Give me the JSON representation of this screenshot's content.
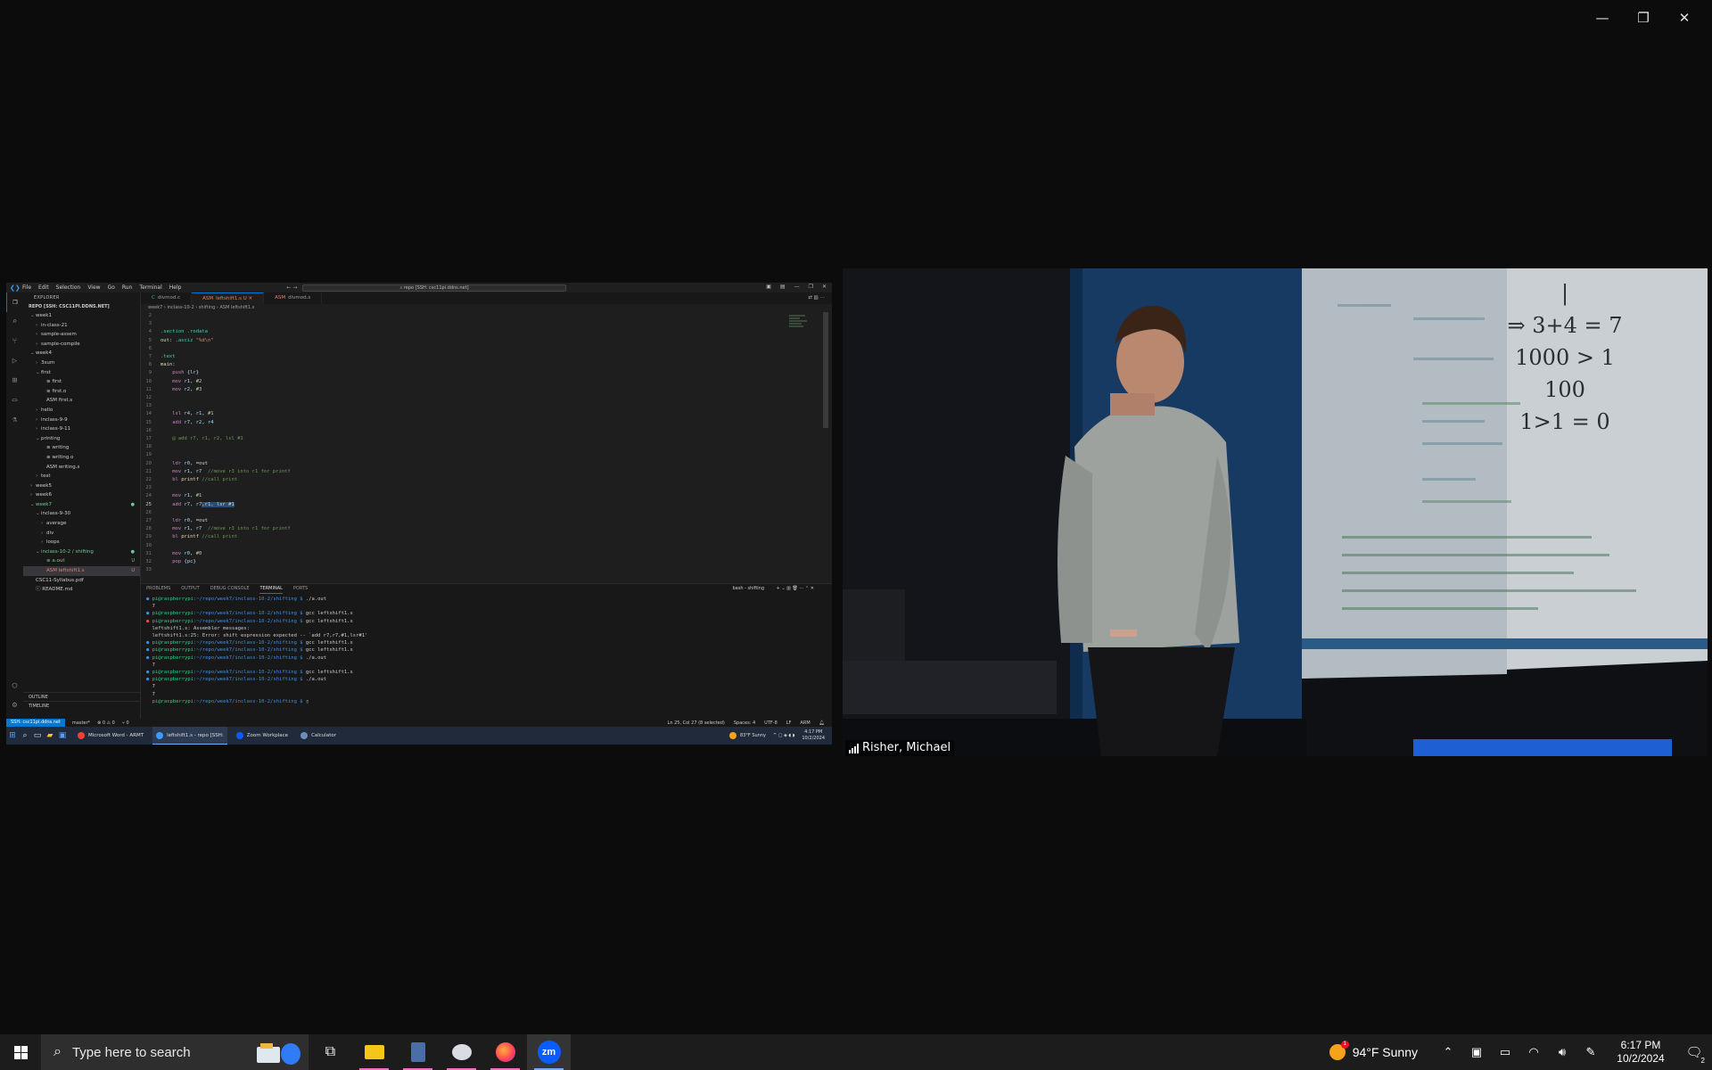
{
  "window_controls": {
    "minimize": "—",
    "restore": "❐",
    "close": "✕"
  },
  "vscode": {
    "menu": [
      "File",
      "Edit",
      "Selection",
      "View",
      "Go",
      "Run",
      "Terminal",
      "Help"
    ],
    "command_center": "repo [SSH: csc11pi.ddns.net]",
    "explorer": {
      "header": "EXPLORER",
      "repo": "REPO [SSH: CSC11PI.DDNS.NET]",
      "items": [
        {
          "label": "week1",
          "depth": 0,
          "chev": "⌄",
          "color": ""
        },
        {
          "label": "in-class-21",
          "depth": 1,
          "chev": "›",
          "color": ""
        },
        {
          "label": "sample-assem",
          "depth": 1,
          "chev": "›",
          "color": ""
        },
        {
          "label": "sample-compile",
          "depth": 1,
          "chev": "›",
          "color": ""
        },
        {
          "label": "week4",
          "depth": 0,
          "chev": "⌄",
          "color": ""
        },
        {
          "label": "3sum",
          "depth": 1,
          "chev": "›",
          "color": ""
        },
        {
          "label": "first",
          "depth": 1,
          "chev": "⌄",
          "color": ""
        },
        {
          "label": "≡ first",
          "depth": 2,
          "chev": "",
          "color": ""
        },
        {
          "label": "≡ first.o",
          "depth": 2,
          "chev": "",
          "color": ""
        },
        {
          "label": "ASM first.s",
          "depth": 2,
          "chev": "",
          "color": ""
        },
        {
          "label": "hello",
          "depth": 1,
          "chev": "›",
          "color": ""
        },
        {
          "label": "inclass-9-9",
          "depth": 1,
          "chev": "›",
          "color": ""
        },
        {
          "label": "inclass-9-11",
          "depth": 1,
          "chev": "›",
          "color": ""
        },
        {
          "label": "printing",
          "depth": 1,
          "chev": "⌄",
          "color": ""
        },
        {
          "label": "≡ writing",
          "depth": 2,
          "chev": "",
          "color": ""
        },
        {
          "label": "≡ writing.o",
          "depth": 2,
          "chev": "",
          "color": ""
        },
        {
          "label": "ASM writing.s",
          "depth": 2,
          "chev": "",
          "color": ""
        },
        {
          "label": "test",
          "depth": 1,
          "chev": "›",
          "color": ""
        },
        {
          "label": "week5",
          "depth": 0,
          "chev": "›",
          "color": ""
        },
        {
          "label": "week6",
          "depth": 0,
          "chev": "›",
          "color": ""
        },
        {
          "label": "week7",
          "depth": 0,
          "chev": "⌄",
          "color": "green",
          "badge": "●"
        },
        {
          "label": "inclass-9-30",
          "depth": 1,
          "chev": "⌄",
          "color": ""
        },
        {
          "label": "average",
          "depth": 2,
          "chev": "›",
          "color": ""
        },
        {
          "label": "div",
          "depth": 2,
          "chev": "›",
          "color": ""
        },
        {
          "label": "loops",
          "depth": 2,
          "chev": "›",
          "color": ""
        },
        {
          "label": "inclass-10-2 / shifting",
          "depth": 1,
          "chev": "⌄",
          "color": "green",
          "badge": "●"
        },
        {
          "label": "≡ a.out",
          "depth": 2,
          "chev": "",
          "color": "green",
          "badge": "U"
        },
        {
          "label": "ASM leftshift1.s",
          "depth": 2,
          "chev": "",
          "color": "red",
          "badge": "U",
          "selected": true
        },
        {
          "label": "CSC11-Syllabus.pdf",
          "depth": 0,
          "chev": "",
          "color": ""
        },
        {
          "label": "ⓘ README.md",
          "depth": 0,
          "chev": "",
          "color": ""
        }
      ],
      "outline": "OUTLINE",
      "timeline": "TIMELINE"
    },
    "tabs": [
      {
        "icon": "C",
        "label": "divmod.c",
        "active": false
      },
      {
        "icon": "ASM",
        "label": "leftshift1.s U",
        "active": true
      },
      {
        "icon": "ASM",
        "label": "divmod.s",
        "active": false
      }
    ],
    "breadcrumb": "week7 › inclass-10-2 › shifting › ASM leftshift1.s",
    "code": [
      {
        "n": "2",
        "html": ""
      },
      {
        "n": "3",
        "html": ""
      },
      {
        "n": "4",
        "html": "<span class='dir'>.section .rodata</span>"
      },
      {
        "n": "5",
        "html": "<span class='lbl'>out:</span> <span class='dir'>.asciz</span> <span class='str'>\"%d\\n\"</span>"
      },
      {
        "n": "6",
        "html": ""
      },
      {
        "n": "7",
        "html": "<span class='dir'>.text</span>"
      },
      {
        "n": "8",
        "html": "<span class='lbl'>main:</span>"
      },
      {
        "n": "9",
        "html": "    <span class='kw'>push</span> <span class='tx'>{</span><span class='reg'>lr</span><span class='tx'>}</span>"
      },
      {
        "n": "10",
        "html": "    <span class='kw'>mov</span> <span class='reg'>r1</span>, <span class='num'>#2</span>"
      },
      {
        "n": "11",
        "html": "    <span class='kw'>mov</span> <span class='reg'>r2</span>, <span class='num'>#3</span>"
      },
      {
        "n": "12",
        "html": ""
      },
      {
        "n": "13",
        "html": ""
      },
      {
        "n": "14",
        "html": "    <span class='kw'>lsl</span> <span class='reg'>r4</span>, <span class='reg'>r1</span>, <span class='num'>#1</span>"
      },
      {
        "n": "15",
        "html": "    <span class='kw'>add</span> <span class='reg'>r7</span>, <span class='reg'>r2</span>, <span class='reg'>r4</span>"
      },
      {
        "n": "16",
        "html": ""
      },
      {
        "n": "17",
        "html": "    <span class='cm'>@ add r7, r1, r2, lsl #1</span>"
      },
      {
        "n": "18",
        "html": ""
      },
      {
        "n": "19",
        "html": ""
      },
      {
        "n": "20",
        "html": "    <span class='kw'>ldr</span> <span class='reg'>r0</span>, <span class='tx'>=out</span>"
      },
      {
        "n": "21",
        "html": "    <span class='kw'>mov</span> <span class='reg'>r1</span>, <span class='reg'>r7</span>  <span class='cm'>//move r3 into r1 for printf</span>"
      },
      {
        "n": "22",
        "html": "    <span class='kw'>bl</span> <span class='lbl'>printf</span> <span class='cm'>//call print</span>"
      },
      {
        "n": "23",
        "html": ""
      },
      {
        "n": "24",
        "html": "    <span class='kw'>mov</span> <span class='reg'>r1</span>, <span class='num'>#1</span>"
      },
      {
        "n": "25",
        "html": "    <span class='kw'>add</span> <span class='reg'>r7</span>, <span class='reg'>r7</span><span class='hl'>,r1, lsr #1</span>",
        "cur": true
      },
      {
        "n": "26",
        "html": ""
      },
      {
        "n": "27",
        "html": "    <span class='kw'>ldr</span> <span class='reg'>r0</span>, <span class='tx'>=out</span>"
      },
      {
        "n": "28",
        "html": "    <span class='kw'>mov</span> <span class='reg'>r1</span>, <span class='reg'>r7</span>  <span class='cm'>//move r3 into r1 for printf</span>"
      },
      {
        "n": "29",
        "html": "    <span class='kw'>bl</span> <span class='lbl'>printf</span> <span class='cm'>//call print</span>"
      },
      {
        "n": "30",
        "html": ""
      },
      {
        "n": "31",
        "html": "    <span class='kw'>mov</span> <span class='reg'>r0</span>, <span class='num'>#0</span>"
      },
      {
        "n": "32",
        "html": "    <span class='kw'>pop</span> <span class='tx'>{</span><span class='reg'>pc</span><span class='tx'>}</span>"
      },
      {
        "n": "33",
        "html": ""
      }
    ],
    "panel": {
      "tabs": [
        "PROBLEMS",
        "OUTPUT",
        "DEBUG CONSOLE",
        "TERMINAL",
        "PORTS"
      ],
      "active_tab": "TERMINAL",
      "shell": "bash - shifting",
      "terminal": [
        {
          "dot": "b",
          "prompt": true,
          "cmd": "./a.out"
        },
        {
          "dot": "",
          "prompt": false,
          "text": "7"
        },
        {
          "dot": "b",
          "prompt": true,
          "cmd": "gcc leftshift1.s"
        },
        {
          "dot": "r",
          "prompt": true,
          "cmd": "gcc leftshift1.s"
        },
        {
          "dot": "",
          "prompt": false,
          "text": "leftshift1.s: Assembler messages:"
        },
        {
          "dot": "",
          "prompt": false,
          "text": "leftshift1.s:25: Error: shift expression expected -- `add r7,r7,#1,lsr#1'"
        },
        {
          "dot": "b",
          "prompt": true,
          "cmd": "gcc leftshift1.s"
        },
        {
          "dot": "b",
          "prompt": true,
          "cmd": "gcc leftshift1.s"
        },
        {
          "dot": "b",
          "prompt": true,
          "cmd": "./a.out"
        },
        {
          "dot": "",
          "prompt": false,
          "text": "7"
        },
        {
          "dot": "b",
          "prompt": true,
          "cmd": "gcc leftshift1.s"
        },
        {
          "dot": "b",
          "prompt": true,
          "cmd": "./a.out"
        },
        {
          "dot": "",
          "prompt": false,
          "text": "7"
        },
        {
          "dot": "",
          "prompt": false,
          "text": "7"
        },
        {
          "dot": "",
          "prompt": true,
          "cmd": "▯"
        }
      ],
      "prompt_user": "pi@raspberrypi",
      "prompt_path": ":~/repo/week7/inclass-10-2/shifting $ "
    },
    "status": {
      "remote": "SSH: csc11pi.ddns.net",
      "branch": "master*",
      "problems": "⊗ 0 ⚠ 0",
      "ports": "⑂ 0",
      "position": "Ln 25, Col 27 (8 selected)",
      "spaces": "Spaces: 4",
      "encoding": "UTF-8",
      "eol": "LF",
      "lang": "ARM"
    },
    "inner_taskbar": {
      "apps": [
        {
          "label": "Microsoft Word - ARMT",
          "color": "#ea4335"
        },
        {
          "label": "leftshift1.s - repo [SSH:",
          "color": "#3b9cff",
          "active": true
        },
        {
          "label": "Zoom Workplace",
          "color": "#0b5cff"
        },
        {
          "label": "Calculator",
          "color": "#6d8db8"
        }
      ],
      "weather": "83°F Sunny",
      "time": "4:17 PM",
      "date": "10/2/2024"
    }
  },
  "video": {
    "participant": "Risher, Michael",
    "board_lines": [
      "|",
      "⇒ 3+4 = 7",
      "1000 > 1",
      "100",
      "1>1 = 0"
    ]
  },
  "taskbar": {
    "search_placeholder": "Type here to search",
    "weather": "94°F  Sunny",
    "weather_badge": "1",
    "time": "6:17 PM",
    "date": "10/2/2024",
    "notifications": "2"
  }
}
